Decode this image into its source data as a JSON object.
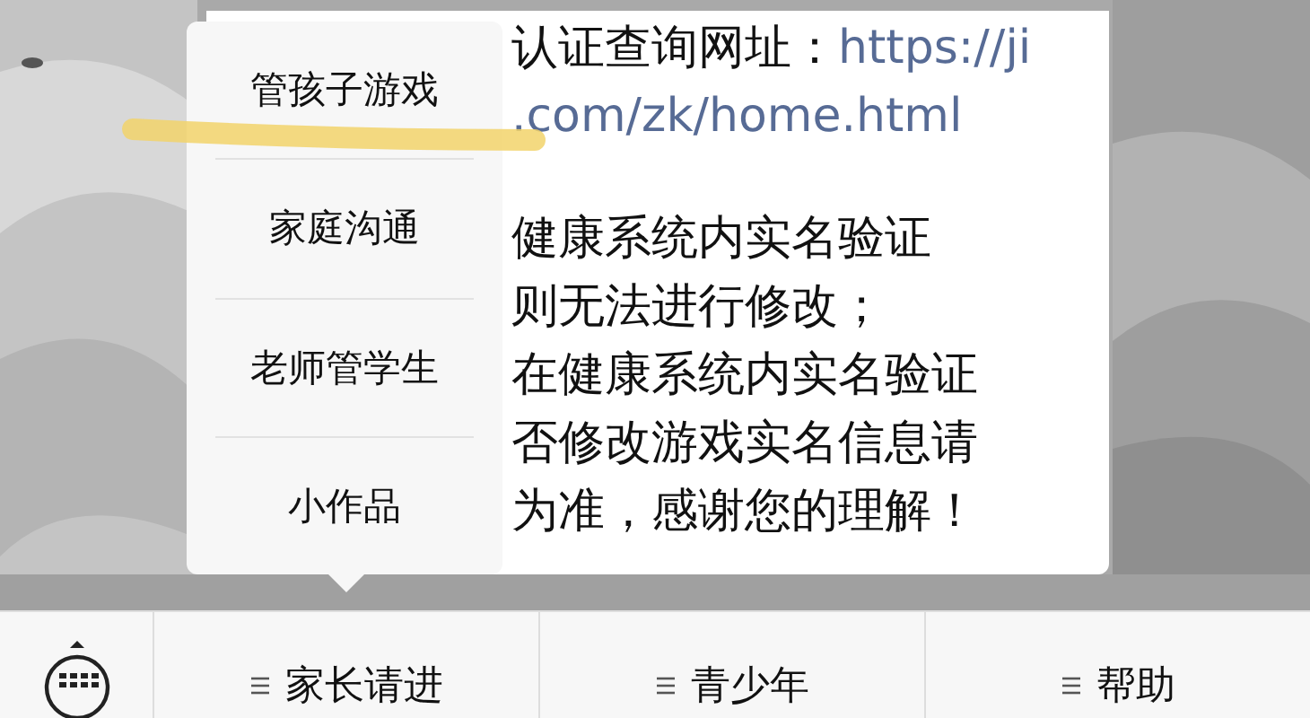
{
  "message": {
    "paragraphs": [
      {
        "lines": [
          {
            "parts": [
              {
                "kind": "text",
                "text": "认证查询网址："
              },
              {
                "kind": "link",
                "text": "https://ji"
              }
            ]
          },
          {
            "parts": [
              {
                "kind": "link",
                "text": ".com/zk/home.html"
              }
            ]
          }
        ]
      },
      {
        "lines": [
          {
            "parts": [
              {
                "kind": "text",
                "text": "健康系统内实名验证"
              }
            ]
          },
          {
            "parts": [
              {
                "kind": "text",
                "text": "则无法进行修改；"
              }
            ]
          },
          {
            "parts": [
              {
                "kind": "text",
                "text": "在健康系统内实名验证"
              }
            ]
          },
          {
            "parts": [
              {
                "kind": "text",
                "text": "否修改游戏实名信息请"
              }
            ]
          },
          {
            "parts": [
              {
                "kind": "text",
                "text": "为准，感谢您的理解！"
              }
            ]
          }
        ]
      }
    ]
  },
  "popup_menu": {
    "items": [
      "管孩子游戏",
      "家庭沟通",
      "老师管学生",
      "小作品"
    ]
  },
  "menu_bar": {
    "items": [
      "家长请进",
      "青少年",
      "帮助"
    ]
  }
}
